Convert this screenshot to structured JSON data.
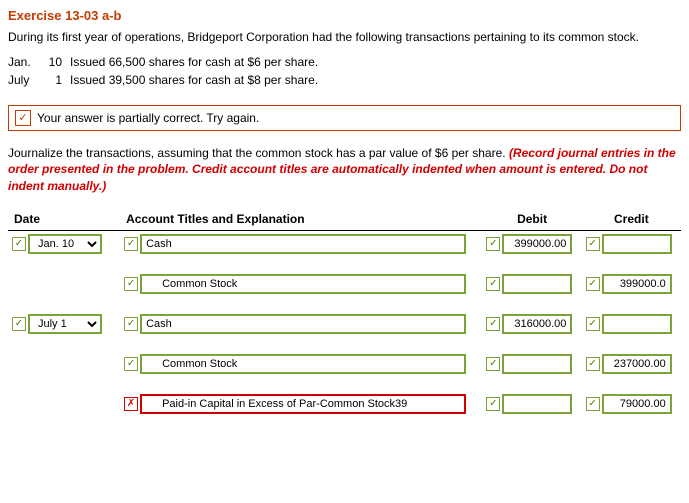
{
  "title": "Exercise 13-03 a-b",
  "intro": "During its first year of operations, Bridgeport Corporation had the following transactions pertaining to its common stock.",
  "transactions": [
    {
      "month": "Jan.",
      "day": "10",
      "desc": "Issued 66,500 shares for cash at $6 per share."
    },
    {
      "month": "July",
      "day": "1",
      "desc": "Issued 39,500 shares for cash at $8 per share."
    }
  ],
  "status_text": "Your answer is partially correct.  Try again.",
  "instructions_plain": "Journalize the transactions, assuming that the common stock has a par value of $6 per share. ",
  "instructions_red": "(Record journal entries in the order presented in the problem. Credit account titles are automatically indented when amount is entered. Do not indent manually.)",
  "headers": {
    "date": "Date",
    "account": "Account Titles and Explanation",
    "debit": "Debit",
    "credit": "Credit"
  },
  "rows": [
    {
      "date": {
        "value": "Jan. 10",
        "status": "ok"
      },
      "account": {
        "value": "Cash",
        "status": "ok",
        "indent": false
      },
      "debit": {
        "value": "399000.00",
        "status": "ok"
      },
      "credit": {
        "value": "",
        "status": "ok"
      }
    },
    {
      "date": null,
      "account": {
        "value": "Common Stock",
        "status": "ok",
        "indent": true
      },
      "debit": {
        "value": "",
        "status": "ok"
      },
      "credit": {
        "value": "399000.0",
        "status": "ok"
      }
    },
    {
      "date": {
        "value": "July 1",
        "status": "ok"
      },
      "account": {
        "value": "Cash",
        "status": "ok",
        "indent": false
      },
      "debit": {
        "value": "316000.00",
        "status": "ok"
      },
      "credit": {
        "value": "",
        "status": "ok"
      }
    },
    {
      "date": null,
      "account": {
        "value": "Common Stock",
        "status": "ok",
        "indent": true
      },
      "debit": {
        "value": "",
        "status": "ok"
      },
      "credit": {
        "value": "237000.00",
        "status": "ok"
      }
    },
    {
      "date": null,
      "account": {
        "value": "Paid-in Capital in Excess of Par-Common Stock39",
        "status": "bad",
        "indent": true
      },
      "debit": {
        "value": "",
        "status": "ok"
      },
      "credit": {
        "value": "79000.00",
        "status": "ok"
      }
    }
  ]
}
